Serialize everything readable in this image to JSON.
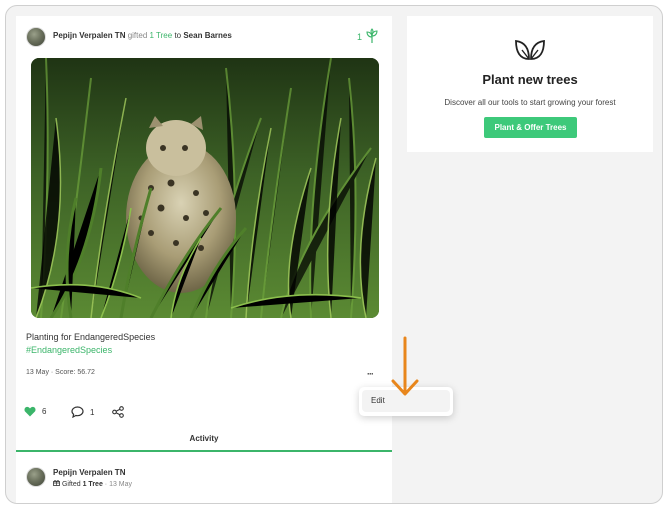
{
  "post": {
    "author": "Pepijn Verpalen TN",
    "action": "gifted",
    "gift": "1 Tree",
    "to_word": "to",
    "recipient": "Sean Barnes",
    "tree_count": "1",
    "caption": "Planting for EndangeredSpecies",
    "hashtag": "#EndangeredSpecies",
    "meta": "13 May · Score: 56.72",
    "more_icon": "···",
    "likes": "6",
    "comments": "1"
  },
  "tabs": {
    "activity": "Activity"
  },
  "activity_item": {
    "name": "Pepijn Verpalen TN",
    "prefix": "Gifted",
    "gift": "1 Tree",
    "date": "· 13 May"
  },
  "promo": {
    "title": "Plant new trees",
    "subtitle": "Discover all our tools to start growing your forest",
    "button": "Plant & Offer Trees"
  },
  "menu": {
    "edit": "Edit"
  },
  "colors": {
    "accent": "#3bb56a",
    "button": "#3dc97a",
    "arrow": "#e8861c"
  }
}
